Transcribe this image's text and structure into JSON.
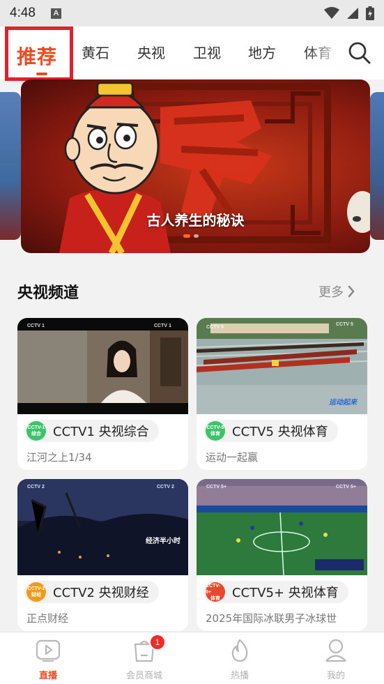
{
  "status_bar": {
    "time": "4:48",
    "notification_letter": "A"
  },
  "top_nav": {
    "tabs": [
      {
        "label": "推荐",
        "active": true
      },
      {
        "label": "黄石"
      },
      {
        "label": "央视"
      },
      {
        "label": "卫视"
      },
      {
        "label": "地方"
      },
      {
        "label": "体育"
      }
    ],
    "search_icon": "search-icon"
  },
  "banner": {
    "caption": "古人养生的秘诀",
    "slide_count": 2,
    "active_slide": 1
  },
  "section": {
    "title": "央视频道",
    "more_label": "更多"
  },
  "channels": [
    {
      "name": "CCTV1 央视综合",
      "program": "江河之上1/34",
      "logo_line1": "CCTV-1",
      "logo_line2": "综合",
      "logo_color": "#3cc46a"
    },
    {
      "name": "CCTV5 央视体育",
      "program": "运动一起赢",
      "logo_line1": "CCTV-5",
      "logo_line2": "体育",
      "logo_color": "#3cc46a"
    },
    {
      "name": "CCTV2 央视财经",
      "program": "正点财经",
      "logo_line1": "CCTV-2",
      "logo_line2": "财经",
      "logo_color": "#f39a1a"
    },
    {
      "name": "CCTV5+ 央视体育",
      "program": "2025年国际冰联男子冰球世",
      "logo_line1": "CCTV-5+",
      "logo_line2": "体育",
      "logo_color": "#e8482c"
    }
  ],
  "thumb_overlays": {
    "cctv2_caption": "经济半小时",
    "cctv5_caption": "运动起来"
  },
  "bottom_nav": {
    "items": [
      {
        "label": "直播",
        "active": true,
        "icon": "play-screen-icon"
      },
      {
        "label": "会员商城",
        "icon": "shopping-bag-icon",
        "badge": "1"
      },
      {
        "label": "热播",
        "icon": "flame-icon"
      },
      {
        "label": "我的",
        "icon": "person-icon"
      }
    ]
  },
  "colors": {
    "accent": "#ee4a22",
    "highlight_border": "#e0202a",
    "badge": "#f12a2a"
  }
}
